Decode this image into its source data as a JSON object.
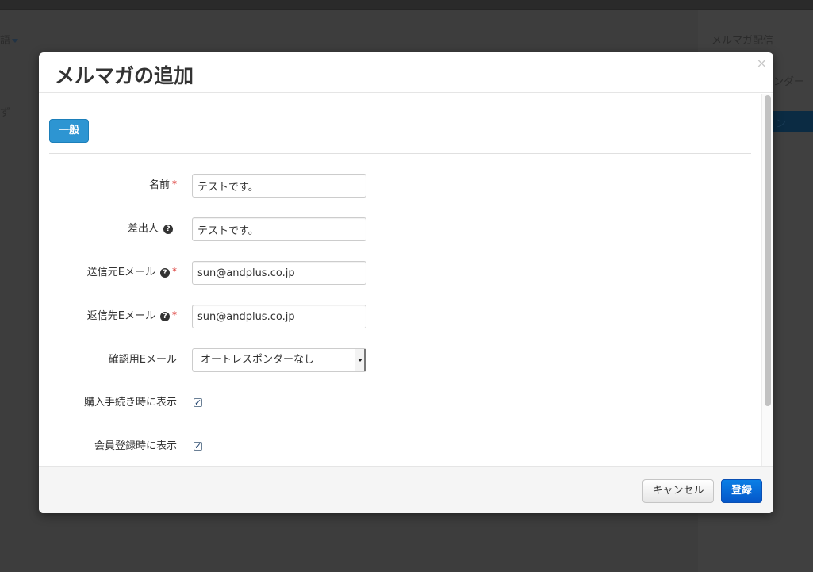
{
  "background": {
    "lang_fragment": "語",
    "left_fragment": "ず",
    "right_menu_mag": "メルマガ配信",
    "right_menu_responder": "ンダー",
    "right_menu_active": "ン"
  },
  "modal": {
    "title": "メルマガの追加",
    "close_glyph": "×",
    "tab_general": "一般",
    "fields": {
      "name": {
        "label": "名前",
        "value": "テストです。"
      },
      "sender": {
        "label": "差出人",
        "value": "テストです。"
      },
      "from_email": {
        "label": "送信元Eメール",
        "value": "sun@andplus.co.jp"
      },
      "reply_email": {
        "label": "返信先Eメール",
        "value": "sun@andplus.co.jp"
      },
      "confirm_email": {
        "label": "確認用Eメール",
        "selected": "オートレスポンダーなし"
      },
      "show_on_purchase": {
        "label": "購入手続き時に表示",
        "checked": true
      },
      "show_on_register": {
        "label": "会員登録時に表示",
        "checked": true
      }
    },
    "required_mark": "*",
    "help_glyph": "?",
    "check_glyph": "✓",
    "footer": {
      "cancel_label": "キャンセル",
      "submit_label": "登録"
    }
  },
  "colors": {
    "primary": "#2d95d2",
    "submit": "#0a6ad9",
    "required": "#d9302c"
  }
}
